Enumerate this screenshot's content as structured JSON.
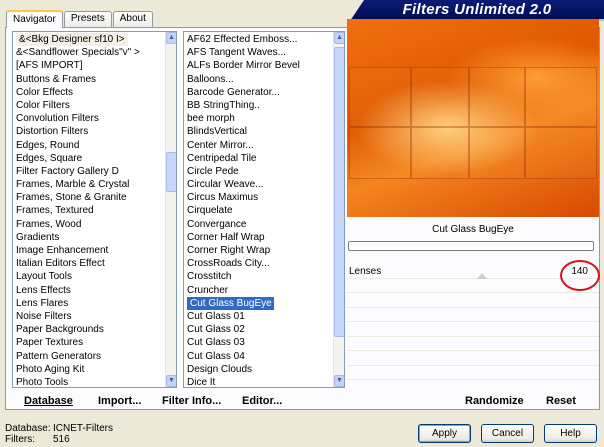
{
  "tabs": [
    "Navigator",
    "Presets",
    "About"
  ],
  "logo_text": "Filters Unlimited 2.0",
  "categories": [
    "&<Bkg Designer sf10 I>",
    "&<Sandflower Specials\"v\" >",
    "[AFS IMPORT]",
    "Buttons & Frames",
    "Color Effects",
    "Color Filters",
    "Convolution Filters",
    "Distortion Filters",
    "Edges, Round",
    "Edges, Square",
    "Filter Factory Gallery D",
    "Frames, Marble & Crystal",
    "Frames, Stone & Granite",
    "Frames, Textured",
    "Frames, Wood",
    "Gradients",
    "Image Enhancement",
    "Italian Editors Effect",
    "Layout Tools",
    "Lens Effects",
    "Lens Flares",
    "Noise Filters",
    "Paper Backgrounds",
    "Paper Textures",
    "Pattern Generators",
    "Photo Aging Kit",
    "Photo Tools"
  ],
  "filters": [
    "AF62 Effected Emboss...",
    "AFS Tangent Waves...",
    "ALFs Border Mirror Bevel",
    "Balloons...",
    "Barcode Generator...",
    "BB StringThing..",
    "bee morph",
    "BlindsVertical",
    "Center Mirror...",
    "Centripedal Tile",
    "Circle Pede",
    "Circular Weave...",
    "Circus Maximus",
    "Cirquelate",
    "Convergance",
    "Corner Half Wrap",
    "Corner Right Wrap",
    "CrossRoads City...",
    "Crosstitch",
    "Cruncher",
    "Cut Glass  BugEye",
    "Cut Glass 01",
    "Cut Glass 02",
    "Cut Glass 03",
    "Cut Glass 04",
    "Design Clouds",
    "Dice It"
  ],
  "selected_filter_index": 20,
  "highlighted_category_index": 0,
  "filter_title": "Cut Glass  BugEye",
  "param": {
    "label": "Lenses",
    "value": "140"
  },
  "links": {
    "database": "Database",
    "import": "Import...",
    "filter_info": "Filter Info...",
    "editor": "Editor...",
    "randomize": "Randomize",
    "reset": "Reset"
  },
  "status": {
    "database_label": "Database:",
    "database_value": "ICNET-Filters",
    "filters_label": "Filters:",
    "filters_value": "516"
  },
  "buttons": {
    "apply": "Apply",
    "cancel": "Cancel",
    "help": "Help"
  },
  "colors": {
    "selection": "#316ac5",
    "logo_bg": "#0d1b78",
    "circle": "#d8121b"
  }
}
